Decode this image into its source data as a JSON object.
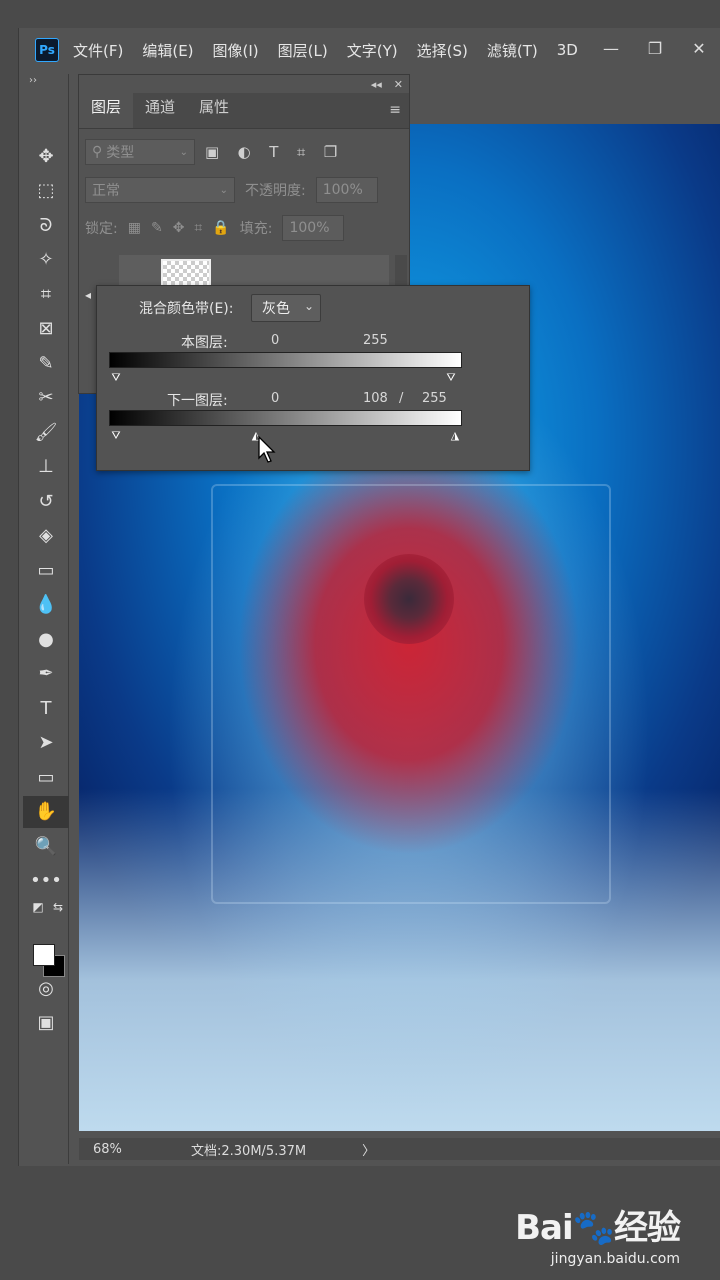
{
  "app": {
    "logo": "Ps"
  },
  "menu": [
    "文件(F)",
    "编辑(E)",
    "图像(I)",
    "图层(L)",
    "文字(Y)",
    "选择(S)",
    "滤镜(T)",
    "3D"
  ],
  "window_controls": {
    "minimize": "—",
    "restore": "❐",
    "close": "✕"
  },
  "toolbar": {
    "collapse": "››",
    "tools": [
      {
        "name": "move-tool",
        "glyph": "✥"
      },
      {
        "name": "marquee-tool",
        "glyph": "⬚"
      },
      {
        "name": "lasso-tool",
        "glyph": "ᘐ"
      },
      {
        "name": "magic-wand-tool",
        "glyph": "✧"
      },
      {
        "name": "crop-tool",
        "glyph": "⌗"
      },
      {
        "name": "frame-tool",
        "glyph": "⊠"
      },
      {
        "name": "eyedropper-tool",
        "glyph": "✎"
      },
      {
        "name": "healing-tool",
        "glyph": "✂"
      },
      {
        "name": "brush-tool",
        "glyph": "🖌"
      },
      {
        "name": "stamp-tool",
        "glyph": "⊥"
      },
      {
        "name": "history-brush-tool",
        "glyph": "↺"
      },
      {
        "name": "eraser-tool",
        "glyph": "◈"
      },
      {
        "name": "gradient-tool",
        "glyph": "▭"
      },
      {
        "name": "blur-tool",
        "glyph": "💧"
      },
      {
        "name": "dodge-tool",
        "glyph": "●"
      },
      {
        "name": "pen-tool",
        "glyph": "✒"
      },
      {
        "name": "type-tool",
        "glyph": "T"
      },
      {
        "name": "path-selection-tool",
        "glyph": "➤"
      },
      {
        "name": "rectangle-tool",
        "glyph": "▭"
      },
      {
        "name": "hand-tool",
        "glyph": "✋"
      },
      {
        "name": "zoom-tool",
        "glyph": "🔍"
      },
      {
        "name": "more-tools",
        "glyph": "•••"
      }
    ],
    "swap_colors": "⇆",
    "default_colors": "◩",
    "quick_mask": "◎",
    "screen_mode": "▣"
  },
  "layers_panel": {
    "collapse": "◂◂",
    "close": "✕",
    "tabs": [
      "图层",
      "通道",
      "属性"
    ],
    "active_tab": "图层",
    "menu_icon": "≡",
    "filter_placeholder": "类型",
    "filter_icons": [
      "▣",
      "◐",
      "T",
      "⌗",
      "❐"
    ],
    "blend_mode": "正常",
    "opacity_label": "不透明度:",
    "opacity_value": "100%",
    "lock_label": "锁定:",
    "fill_label": "填充:",
    "fill_value": "100%"
  },
  "blend_if": {
    "band_label": "混合颜色带(E):",
    "band_value": "灰色",
    "this_layer_label": "本图层:",
    "this_layer_low": "0",
    "this_layer_high": "255",
    "underlying_label": "下一图层:",
    "underlying_low": "0",
    "underlying_mid": "108",
    "underlying_sep": "/",
    "underlying_high": "255"
  },
  "status": {
    "zoom": "68%",
    "doc": "文档:2.30M/5.37M",
    "arrow": "〉"
  },
  "watermark": {
    "logo": "Bai🐾经验",
    "url": "jingyan.baidu.com"
  }
}
